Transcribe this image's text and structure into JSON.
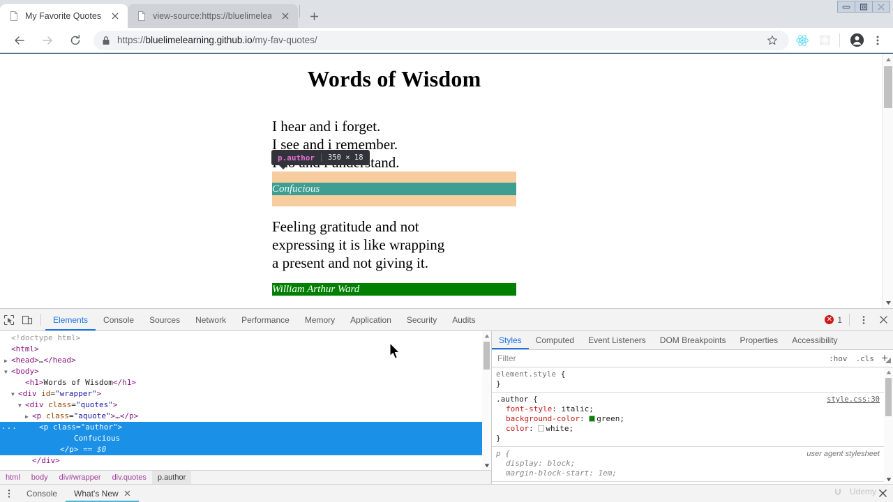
{
  "window": {
    "controls": [
      "minimize",
      "restore",
      "close"
    ]
  },
  "browser": {
    "tabs": [
      {
        "title": "My Favorite Quotes",
        "active": true,
        "favicon": "page-icon"
      },
      {
        "title": "view-source:https://bluelimelearn",
        "active": false,
        "favicon": "page-icon"
      }
    ],
    "new_tab_label": "+",
    "toolbar": {
      "back": "back-arrow",
      "forward": "forward-arrow",
      "reload": "reload",
      "lock_icon": "lock-icon",
      "url_scheme": "https://",
      "url_host": "bluelimelearning.github.io",
      "url_path": "/my-fav-quotes/",
      "bookmark_icon": "star-icon",
      "extension_react": "react-icon",
      "extension_grid": "extension-icon",
      "profile_icon": "avatar-icon",
      "menu_icon": "kebab-menu-icon"
    }
  },
  "page": {
    "title": "Words of Wisdom",
    "quotes": [
      {
        "lines": [
          "I hear and i forget.",
          "I see and i remember.",
          "I do and i understand."
        ],
        "author": "Confucious",
        "highlighted": true
      },
      {
        "lines": [
          "Feeling gratitude and not",
          "expressing it is like wrapping",
          "a present and not giving it."
        ],
        "author": "William Arthur Ward",
        "highlighted": false
      }
    ],
    "inspect_tooltip": {
      "selector": "p.author",
      "dimensions": "350 × 18"
    },
    "highlight_colors": {
      "content": "#3f9e92",
      "margin": "#f7cc9f"
    },
    "author_style_colors": {
      "background": "#008000",
      "text": "#ffffff"
    }
  },
  "devtools": {
    "toolbar": {
      "inspect_icon": "inspect-element-icon",
      "device_icon": "device-toolbar-icon",
      "tabs": [
        {
          "label": "Elements",
          "active": true
        },
        {
          "label": "Console",
          "active": false
        },
        {
          "label": "Sources",
          "active": false
        },
        {
          "label": "Network",
          "active": false
        },
        {
          "label": "Performance",
          "active": false
        },
        {
          "label": "Memory",
          "active": false
        },
        {
          "label": "Application",
          "active": false
        },
        {
          "label": "Security",
          "active": false
        },
        {
          "label": "Audits",
          "active": false
        }
      ],
      "error_count": "1",
      "kebab_icon": "kebab-menu-icon",
      "close_icon": "close-icon"
    },
    "dom_tree": [
      {
        "indent": 0,
        "twisty": "",
        "html": "<span class='doctype'>&lt;!doctype html&gt;</span>",
        "selected": false
      },
      {
        "indent": 0,
        "twisty": "",
        "html": "<span class='punc'>&lt;</span><span class='tagname'>html</span><span class='punc'>&gt;</span>",
        "selected": false
      },
      {
        "indent": 0,
        "twisty": "▶",
        "html": "<span class='punc'>&lt;</span><span class='tagname'>head</span><span class='punc'>&gt;</span><span class='txt'>…</span><span class='punc'>&lt;/</span><span class='tagname'>head</span><span class='punc'>&gt;</span>",
        "selected": false
      },
      {
        "indent": 0,
        "twisty": "▼",
        "html": "<span class='punc'>&lt;</span><span class='tagname'>body</span><span class='punc'>&gt;</span>",
        "selected": false
      },
      {
        "indent": 2,
        "twisty": "",
        "html": "<span class='punc'>&lt;</span><span class='tagname'>h1</span><span class='punc'>&gt;</span><span class='txt'>Words of Wisdom</span><span class='punc'>&lt;/</span><span class='tagname'>h1</span><span class='punc'>&gt;</span>",
        "selected": false
      },
      {
        "indent": 1,
        "twisty": "▼",
        "html": "<span class='punc'>&lt;</span><span class='tagname'>div</span> <span class='attrname'>id</span>=<span class='attrval'>\"wrapper\"</span><span class='punc'>&gt;</span>",
        "selected": false
      },
      {
        "indent": 2,
        "twisty": "▼",
        "html": "<span class='punc'>&lt;</span><span class='tagname'>div</span> <span class='attrname'>class</span>=<span class='attrval'>\"quotes\"</span><span class='punc'>&gt;</span>",
        "selected": false
      },
      {
        "indent": 3,
        "twisty": "▶",
        "html": "<span class='punc'>&lt;</span><span class='tagname'>p</span> <span class='attrname'>class</span>=<span class='attrval'>\"aquote\"</span><span class='punc'>&gt;</span><span class='txt'>…</span><span class='punc'>&lt;/</span><span class='tagname'>p</span><span class='punc'>&gt;</span>",
        "selected": false
      },
      {
        "indent": 4,
        "twisty": "",
        "html": "<span class='punc'>&lt;</span><span class='tagname'>p</span> <span class='attrname'>class</span>=<span class='attrval'>\"author\"</span><span class='punc'>&gt;</span>",
        "selected": true
      },
      {
        "indent": 9,
        "twisty": "",
        "html": "<span class='txt'>Confucious</span>",
        "selected": true
      },
      {
        "indent": 7,
        "twisty": "",
        "html": "<span class='punc'>&lt;/</span><span class='tagname'>p</span><span class='punc'>&gt;</span> <span class='dollar'>== $0</span>",
        "selected": true
      },
      {
        "indent": 3,
        "twisty": "",
        "html": "<span class='punc'>&lt;/</span><span class='tagname'>div</span><span class='punc'>&gt;</span>",
        "selected": false
      }
    ],
    "breadcrumbs": [
      {
        "label": "html",
        "active": false
      },
      {
        "label": "body",
        "active": false
      },
      {
        "label": "div#wrapper",
        "active": false
      },
      {
        "label": "div.quotes",
        "active": false
      },
      {
        "label": "p.author",
        "active": true
      }
    ],
    "styles": {
      "tabs": [
        {
          "label": "Styles",
          "active": true
        },
        {
          "label": "Computed",
          "active": false
        },
        {
          "label": "Event Listeners",
          "active": false
        },
        {
          "label": "DOM Breakpoints",
          "active": false
        },
        {
          "label": "Properties",
          "active": false
        },
        {
          "label": "Accessibility",
          "active": false
        }
      ],
      "filter_placeholder": "Filter",
      "filter_value": "",
      "hov_label": ":hov",
      "cls_label": ".cls",
      "new_rule_label": "+",
      "rules": [
        {
          "selector": "element.style",
          "origin": "",
          "origin_type": "none",
          "properties": []
        },
        {
          "selector": ".author",
          "origin": "style.css:30",
          "origin_type": "link",
          "properties": [
            {
              "name": "font-style",
              "value": "italic",
              "swatch": ""
            },
            {
              "name": "background-color",
              "value": "green",
              "swatch": "#008000"
            },
            {
              "name": "color",
              "value": "white",
              "swatch": "#ffffff"
            }
          ]
        },
        {
          "selector": "p",
          "origin": "user agent stylesheet",
          "origin_type": "ua",
          "properties": [
            {
              "name": "display",
              "value": "block",
              "swatch": ""
            },
            {
              "name": "margin-block-start",
              "value": "1em",
              "swatch": ""
            }
          ]
        }
      ]
    },
    "drawer": {
      "kebab_icon": "kebab-menu-icon",
      "tabs": [
        {
          "label": "Console",
          "active": false,
          "closable": false
        },
        {
          "label": "What's New",
          "active": true,
          "closable": true
        }
      ],
      "close_icon": "close-icon"
    }
  },
  "watermark": {
    "text": "Udemy"
  }
}
